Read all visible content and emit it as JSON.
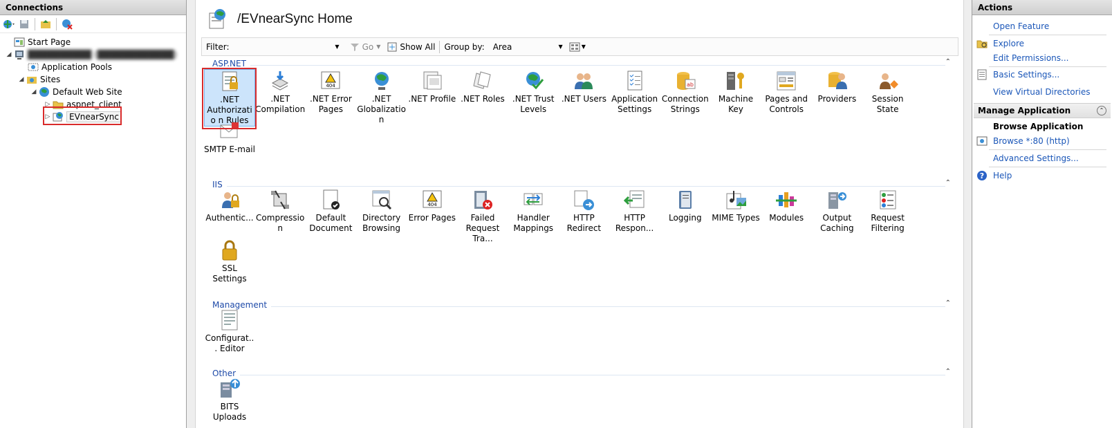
{
  "connections": {
    "header": "Connections",
    "tree": {
      "start_page": "Start Page",
      "server": "██████████ (████████████)",
      "app_pools": "Application Pools",
      "sites": "Sites",
      "default_site": "Default Web Site",
      "aspnet_client": "aspnet_client",
      "selected": "EVnearSync"
    }
  },
  "main": {
    "title": "/EVnearSync Home",
    "filter": {
      "label": "Filter:",
      "go_label": "Go",
      "show_all_label": "Show All",
      "group_by_label": "Group by:",
      "group_by_value": "Area"
    },
    "sections": {
      "aspnet": {
        "title": "ASP.NET",
        "features": [
          {
            "label": ".NET Authorizatio n Rules",
            "icon": "authorization-rules-icon"
          },
          {
            "label": ".NET Compilation",
            "icon": "compilation-icon"
          },
          {
            "label": ".NET Error Pages",
            "icon": "error-pages-icon"
          },
          {
            "label": ".NET Globalization",
            "icon": "globe-icon"
          },
          {
            "label": ".NET Profile",
            "icon": "profile-icon"
          },
          {
            "label": ".NET Roles",
            "icon": "roles-icon"
          },
          {
            "label": ".NET Trust Levels",
            "icon": "trust-levels-icon"
          },
          {
            "label": ".NET Users",
            "icon": "users-icon"
          },
          {
            "label": "Application Settings",
            "icon": "settings-list-icon"
          },
          {
            "label": "Connection Strings",
            "icon": "database-icon"
          },
          {
            "label": "Machine Key",
            "icon": "key-icon"
          },
          {
            "label": "Pages and Controls",
            "icon": "pages-controls-icon"
          },
          {
            "label": "Providers",
            "icon": "providers-icon"
          },
          {
            "label": "Session State",
            "icon": "session-state-icon"
          },
          {
            "label": "SMTP E-mail",
            "icon": "email-icon"
          }
        ]
      },
      "iis": {
        "title": "IIS",
        "features": [
          {
            "label": "Authentic...",
            "icon": "authentication-icon"
          },
          {
            "label": "Compression",
            "icon": "compression-icon"
          },
          {
            "label": "Default Document",
            "icon": "default-document-icon"
          },
          {
            "label": "Directory Browsing",
            "icon": "directory-browsing-icon"
          },
          {
            "label": "Error Pages",
            "icon": "error-pages-icon"
          },
          {
            "label": "Failed Request Tra...",
            "icon": "failed-request-icon"
          },
          {
            "label": "Handler Mappings",
            "icon": "handler-mappings-icon"
          },
          {
            "label": "HTTP Redirect",
            "icon": "http-redirect-icon"
          },
          {
            "label": "HTTP Respon...",
            "icon": "http-response-icon"
          },
          {
            "label": "Logging",
            "icon": "logging-icon"
          },
          {
            "label": "MIME Types",
            "icon": "mime-types-icon"
          },
          {
            "label": "Modules",
            "icon": "modules-icon"
          },
          {
            "label": "Output Caching",
            "icon": "output-caching-icon"
          },
          {
            "label": "Request Filtering",
            "icon": "request-filtering-icon"
          },
          {
            "label": "SSL Settings",
            "icon": "lock-icon"
          }
        ]
      },
      "management": {
        "title": "Management",
        "features": [
          {
            "label": "Configurat... Editor",
            "icon": "config-editor-icon"
          }
        ]
      },
      "other": {
        "title": "Other",
        "features": [
          {
            "label": "BITS Uploads",
            "icon": "bits-uploads-icon"
          }
        ]
      }
    }
  },
  "actions": {
    "header": "Actions",
    "open_feature": "Open Feature",
    "explore": "Explore",
    "edit_permissions": "Edit Permissions...",
    "basic_settings": "Basic Settings...",
    "view_virtual_dirs": "View Virtual Directories",
    "manage_application": "Manage Application",
    "browse_application": "Browse Application",
    "browse_80": "Browse *:80 (http)",
    "advanced_settings": "Advanced Settings...",
    "help": "Help"
  },
  "colors": {
    "link": "#1a56b8",
    "section_title": "#1e4aa8",
    "highlight_red": "#d92b2b",
    "selection_blue": "#cce4fb"
  }
}
